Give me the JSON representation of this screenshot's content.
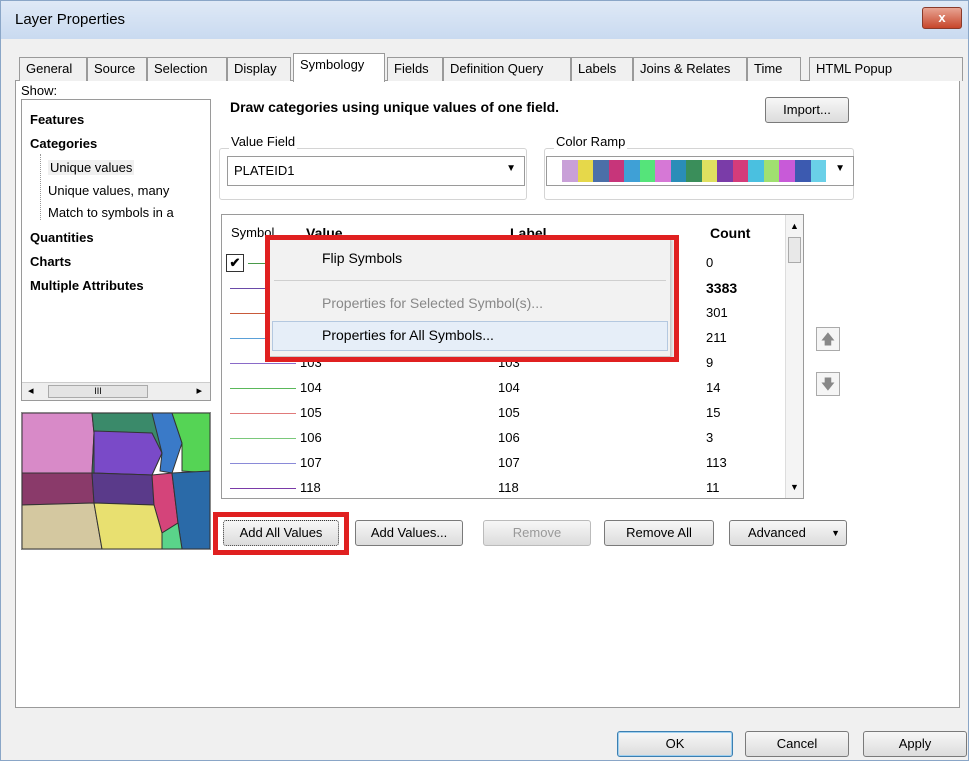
{
  "window": {
    "title": "Layer Properties",
    "close": "x"
  },
  "tabs": [
    "General",
    "Source",
    "Selection",
    "Display",
    "Symbology",
    "Fields",
    "Definition Query",
    "Labels",
    "Joins & Relates",
    "Time",
    "HTML Popup"
  ],
  "show": {
    "label": "Show:",
    "items": [
      {
        "label": "Features",
        "bold": true
      },
      {
        "label": "Categories",
        "bold": true
      },
      {
        "label": "Unique values",
        "bold": false
      },
      {
        "label": "Unique values, many",
        "bold": false
      },
      {
        "label": "Match to symbols in a",
        "bold": false
      },
      {
        "label": "Quantities",
        "bold": true
      },
      {
        "label": "Charts",
        "bold": true
      },
      {
        "label": "Multiple Attributes",
        "bold": true
      }
    ],
    "scroll_mark": "III"
  },
  "heading": "Draw categories using unique values of one field.",
  "import_label": "Import...",
  "value_field": {
    "label": "Value Field",
    "value": "PLATEID1"
  },
  "color_ramp": {
    "label": "Color Ramp",
    "colors": [
      "#c9a0d8",
      "#e6d84a",
      "#4b6fa8",
      "#c7357a",
      "#3fa0d6",
      "#55e47a",
      "#d678d6",
      "#2a8db8",
      "#3a8e5a",
      "#e0e060",
      "#7a3ca8",
      "#d43c7a",
      "#4ac0e0",
      "#a0e070",
      "#c85ad8",
      "#3c5ab0",
      "#6ad0e8"
    ]
  },
  "columns": {
    "symbol": "Symbol",
    "value": "Value",
    "label": "Label",
    "count": "Count"
  },
  "rows": [
    {
      "value": "",
      "label": "",
      "count": "0",
      "color": "#4a9a4a",
      "checked": true
    },
    {
      "value": "",
      "label": "",
      "count": "3383",
      "color": "#6a4aa8",
      "bold": true
    },
    {
      "value": "",
      "label": "",
      "count": "301",
      "color": "#c85a3a"
    },
    {
      "value": "",
      "label": "",
      "count": "211",
      "color": "#5aa0d8"
    },
    {
      "value": "103",
      "label": "103",
      "count": "9",
      "color": "#8a6ac8"
    },
    {
      "value": "104",
      "label": "104",
      "count": "14",
      "color": "#5ab85a"
    },
    {
      "value": "105",
      "label": "105",
      "count": "15",
      "color": "#e07a7a"
    },
    {
      "value": "106",
      "label": "106",
      "count": "3",
      "color": "#7ac87a"
    },
    {
      "value": "107",
      "label": "107",
      "count": "113",
      "color": "#8a8ad8"
    },
    {
      "value": "118",
      "label": "118",
      "count": "11",
      "color": "#7a3aa8"
    }
  ],
  "context_menu": [
    "Flip Symbols",
    "Properties for Selected Symbol(s)...",
    "Properties for All Symbols..."
  ],
  "buttons": {
    "add_all": "Add All Values",
    "add": "Add Values...",
    "remove": "Remove",
    "remove_all": "Remove All",
    "advanced": "Advanced",
    "ok": "OK",
    "cancel": "Cancel",
    "apply": "Apply"
  },
  "accent": "#e02020"
}
